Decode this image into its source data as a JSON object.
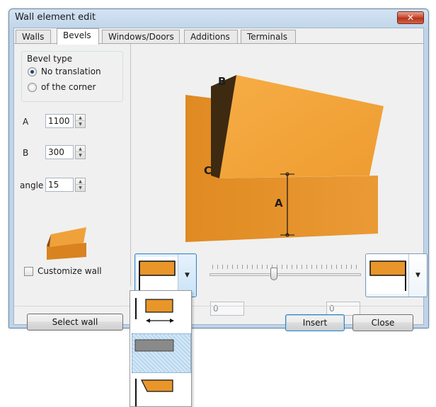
{
  "window": {
    "title": "Wall element edit",
    "close_glyph": "✕"
  },
  "tabs": [
    {
      "label": "Walls",
      "active": false
    },
    {
      "label": "Bevels",
      "active": true
    },
    {
      "label": "Windows/Doors",
      "active": false
    },
    {
      "label": "Additions",
      "active": false
    },
    {
      "label": "Terminals",
      "active": false
    }
  ],
  "bevel_type": {
    "title": "Bevel type",
    "options": [
      {
        "label": "No translation",
        "checked": true
      },
      {
        "label": "of the corner",
        "checked": false
      }
    ]
  },
  "fields": {
    "a_label": "A",
    "a_value": "1100",
    "b_label": "B",
    "b_value": "300",
    "angle_label": "angle",
    "angle_value": "15"
  },
  "customize_wall": {
    "label": "Customize wall",
    "checked": false
  },
  "preview": {
    "label_a": "A",
    "label_b": "B",
    "label_c": "C",
    "wall_color": "#e8962a"
  },
  "slider": {
    "fraction": 0.42
  },
  "left_offset_value": "0",
  "right_offset_value": "0",
  "buttons": {
    "select_wall": "Select wall",
    "insert": "Insert",
    "close": "Close"
  },
  "dropdown_arrow_glyph": "▼",
  "spinner_up_glyph": "▲",
  "spinner_down_glyph": "▼",
  "colors": {
    "accent_orange": "#e8962a",
    "selection_blue": "#b6d6ee"
  }
}
